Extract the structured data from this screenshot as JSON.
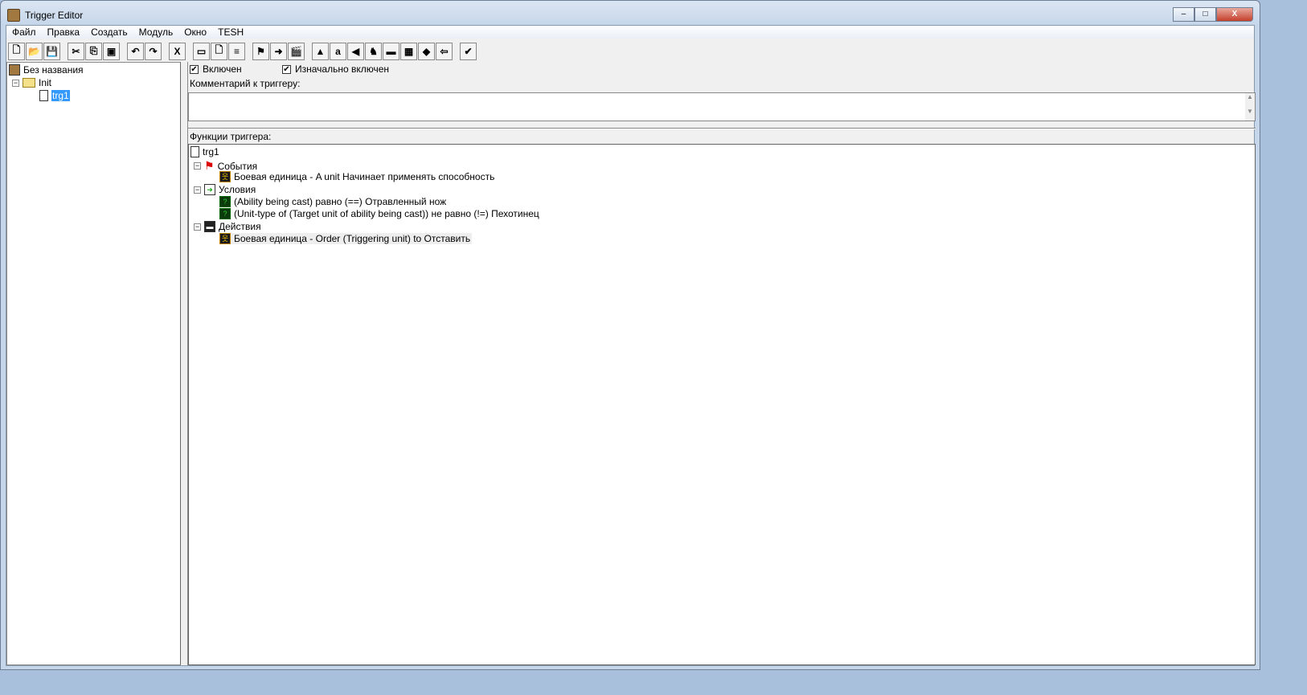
{
  "window": {
    "title": "Trigger Editor",
    "min": "–",
    "max": "□",
    "close": "X"
  },
  "menu": [
    "Файл",
    "Правка",
    "Создать",
    "Модуль",
    "Окно",
    "TESH"
  ],
  "toolbar": [
    {
      "name": "new",
      "glyph": "🗋"
    },
    {
      "name": "open",
      "glyph": "📂"
    },
    {
      "name": "save",
      "glyph": "💾"
    },
    null,
    {
      "name": "cut",
      "glyph": "✂"
    },
    {
      "name": "copy",
      "glyph": "⎘"
    },
    {
      "name": "paste",
      "glyph": "▣"
    },
    null,
    {
      "name": "undo",
      "glyph": "↶"
    },
    {
      "name": "redo",
      "glyph": "↷"
    },
    null,
    {
      "name": "delete",
      "glyph": "X"
    },
    null,
    {
      "name": "new-category",
      "glyph": "▭"
    },
    {
      "name": "new-trigger",
      "glyph": "🗋"
    },
    {
      "name": "new-comment",
      "glyph": "≡"
    },
    null,
    {
      "name": "new-event",
      "glyph": "⚑"
    },
    {
      "name": "new-condition",
      "glyph": "➜"
    },
    {
      "name": "new-action",
      "glyph": "🎬"
    },
    null,
    {
      "name": "terrain-editor",
      "glyph": "▲"
    },
    {
      "name": "object-editor",
      "glyph": "a"
    },
    {
      "name": "sound-editor",
      "glyph": "◀"
    },
    {
      "name": "ai-editor",
      "glyph": "♞"
    },
    {
      "name": "campaign-editor",
      "glyph": "▬"
    },
    {
      "name": "import-manager",
      "glyph": "▦"
    },
    {
      "name": "object-manager",
      "glyph": "◆"
    },
    {
      "name": "import-file",
      "glyph": "⇦"
    },
    null,
    {
      "name": "test-map",
      "glyph": "✔"
    }
  ],
  "left_tree": {
    "root": "Без названия",
    "category": "Init",
    "trigger": "trg1"
  },
  "trigger": {
    "enabled_label": "Включен",
    "enabled": true,
    "initially_on_label": "Изначально включен",
    "initially_on": true,
    "comment_label": "Комментарий к триггеру:",
    "comment": "",
    "functions_label": "Функции триггера:"
  },
  "functions": {
    "name": "trg1",
    "events_label": "События",
    "events": [
      "Боевая единица - A unit Начинает применять способность"
    ],
    "conditions_label": "Условия",
    "conditions": [
      "(Ability being cast) равно (==) Отравленный нож",
      "(Unit-type of (Target unit of ability being cast)) не равно (!=) Пехотинец"
    ],
    "actions_label": "Действия",
    "actions": [
      "Боевая единица - Order (Triggering unit) to Отставить"
    ]
  }
}
